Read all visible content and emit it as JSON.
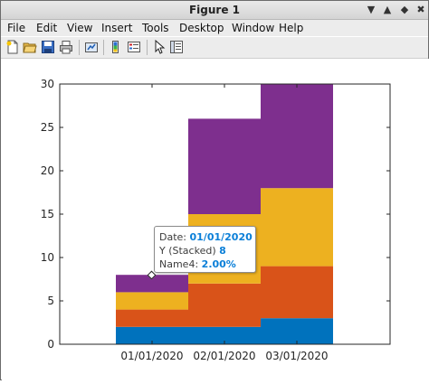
{
  "window": {
    "title": "Figure 1"
  },
  "menu": {
    "items": [
      "File",
      "Edit",
      "View",
      "Insert",
      "Tools",
      "Desktop",
      "Window",
      "Help"
    ],
    "underline_index": [
      0,
      0,
      0,
      0,
      0,
      0,
      0,
      0
    ]
  },
  "toolbar": {
    "icons": [
      "new-figure-icon",
      "open-file-icon",
      "save-icon",
      "print-icon",
      "link-icon",
      "insert-colorbar-icon",
      "insert-legend-icon",
      "pointer-icon",
      "property-editor-icon"
    ]
  },
  "colors": {
    "c1": "#0072BD",
    "c2": "#D95319",
    "c3": "#EDB120",
    "c4": "#7E2F8E"
  },
  "chart_data": {
    "type": "bar",
    "stacked": true,
    "categories": [
      "01/01/2020",
      "02/01/2020",
      "03/01/2020"
    ],
    "series": [
      {
        "values": [
          2,
          2,
          3
        ]
      },
      {
        "values": [
          2,
          5,
          6
        ]
      },
      {
        "values": [
          2,
          8,
          9
        ]
      },
      {
        "values": [
          2,
          11,
          12
        ]
      }
    ],
    "ylim": [
      0,
      30
    ],
    "yticks": [
      0,
      5,
      10,
      15,
      20,
      25,
      30
    ],
    "grid": false
  },
  "datatip": {
    "line1_label": "Date:",
    "line1_value": "01/01/2020",
    "line2_label": "Y (Stacked)",
    "line2_value": "8",
    "line3_label": "Name4:",
    "line3_value": "2.00%"
  }
}
